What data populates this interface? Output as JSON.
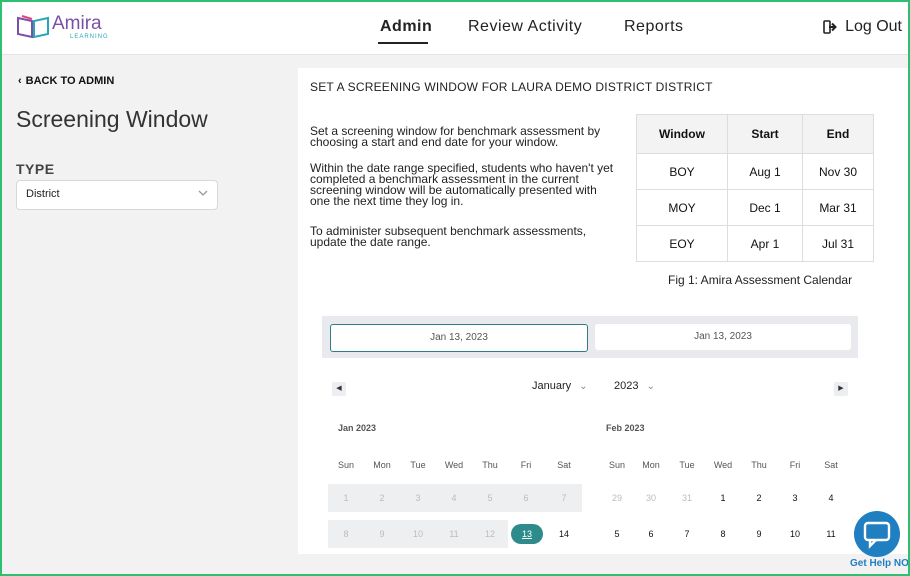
{
  "brand": {
    "name": "Amira",
    "sub": "LEARNING",
    "color": "#7b4fa8"
  },
  "nav": {
    "items": [
      "Admin",
      "Review Activity",
      "Reports"
    ],
    "active": "Admin",
    "logout": "Log Out"
  },
  "sidebar": {
    "back": "BACK TO ADMIN",
    "title": "Screening Window",
    "type_label": "TYPE",
    "type_value": "District"
  },
  "main": {
    "heading": "SET A SCREENING WINDOW FOR LAURA DEMO DISTRICT DISTRICT",
    "para1": "Set a screening window for benchmark assessment by choosing a start and end date for your window.",
    "para2": "Within the date range specified, students who haven't yet completed a benchmark assessment in the current screening window will be automatically presented with one the next time they log in.",
    "para3": "To administer subsequent benchmark assessments, update the date range.",
    "calendar_table": {
      "headers": [
        "Window",
        "Start",
        "End"
      ],
      "rows": [
        [
          "BOY",
          "Aug 1",
          "Nov 30"
        ],
        [
          "MOY",
          "Dec 1",
          "Mar 31"
        ],
        [
          "EOY",
          "Apr 1",
          "Jul 31"
        ]
      ],
      "caption": "Fig 1: Amira Assessment Calendar"
    },
    "range": {
      "start": "Jan 13, 2023",
      "end": "Jan 13, 2023"
    },
    "picker": {
      "month": "January",
      "year": "2023",
      "left_title": "Jan 2023",
      "right_title": "Feb 2023",
      "dows": [
        "Sun",
        "Mon",
        "Tue",
        "Wed",
        "Thu",
        "Fri",
        "Sat"
      ],
      "left_row1": [
        "1",
        "2",
        "3",
        "4",
        "5",
        "6",
        "7"
      ],
      "left_row2": [
        "8",
        "9",
        "10",
        "11",
        "12",
        "13",
        "14"
      ],
      "right_row1": [
        "29",
        "30",
        "31",
        "1",
        "2",
        "3",
        "4"
      ],
      "right_row2": [
        "5",
        "6",
        "7",
        "8",
        "9",
        "10",
        "11"
      ],
      "selected": "13",
      "accent": "#2e8b8b"
    }
  },
  "help": {
    "label": "Get Help NOW",
    "color": "#1f7fc1",
    "icon": "chat-bubble-icon"
  }
}
